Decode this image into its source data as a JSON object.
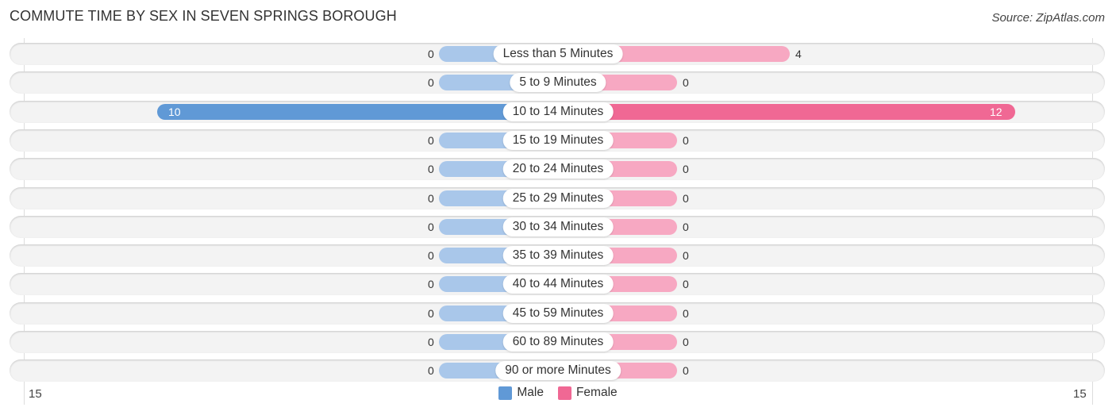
{
  "chart_data": {
    "type": "bar",
    "orientation": "horizontal-diverging",
    "title": "COMMUTE TIME BY SEX IN SEVEN SPRINGS BOROUGH",
    "source": "Source: ZipAtlas.com",
    "categories": [
      "Less than 5 Minutes",
      "5 to 9 Minutes",
      "10 to 14 Minutes",
      "15 to 19 Minutes",
      "20 to 24 Minutes",
      "25 to 29 Minutes",
      "30 to 34 Minutes",
      "35 to 39 Minutes",
      "40 to 44 Minutes",
      "45 to 59 Minutes",
      "60 to 89 Minutes",
      "90 or more Minutes"
    ],
    "series": [
      {
        "name": "Male",
        "color": "#6099d6",
        "light_color": "#a9c7ea",
        "values": [
          0,
          0,
          10,
          0,
          0,
          0,
          0,
          0,
          0,
          0,
          0,
          0
        ]
      },
      {
        "name": "Female",
        "color": "#f06894",
        "light_color": "#f7a8c2",
        "values": [
          4,
          0,
          12,
          0,
          0,
          0,
          0,
          0,
          0,
          0,
          0,
          0
        ]
      }
    ],
    "axis": {
      "min_label": "15",
      "max_label": "15",
      "range": [
        -15,
        15
      ]
    },
    "legend": {
      "position": "bottom-center",
      "entries": [
        "Male",
        "Female"
      ]
    },
    "grid": false
  }
}
